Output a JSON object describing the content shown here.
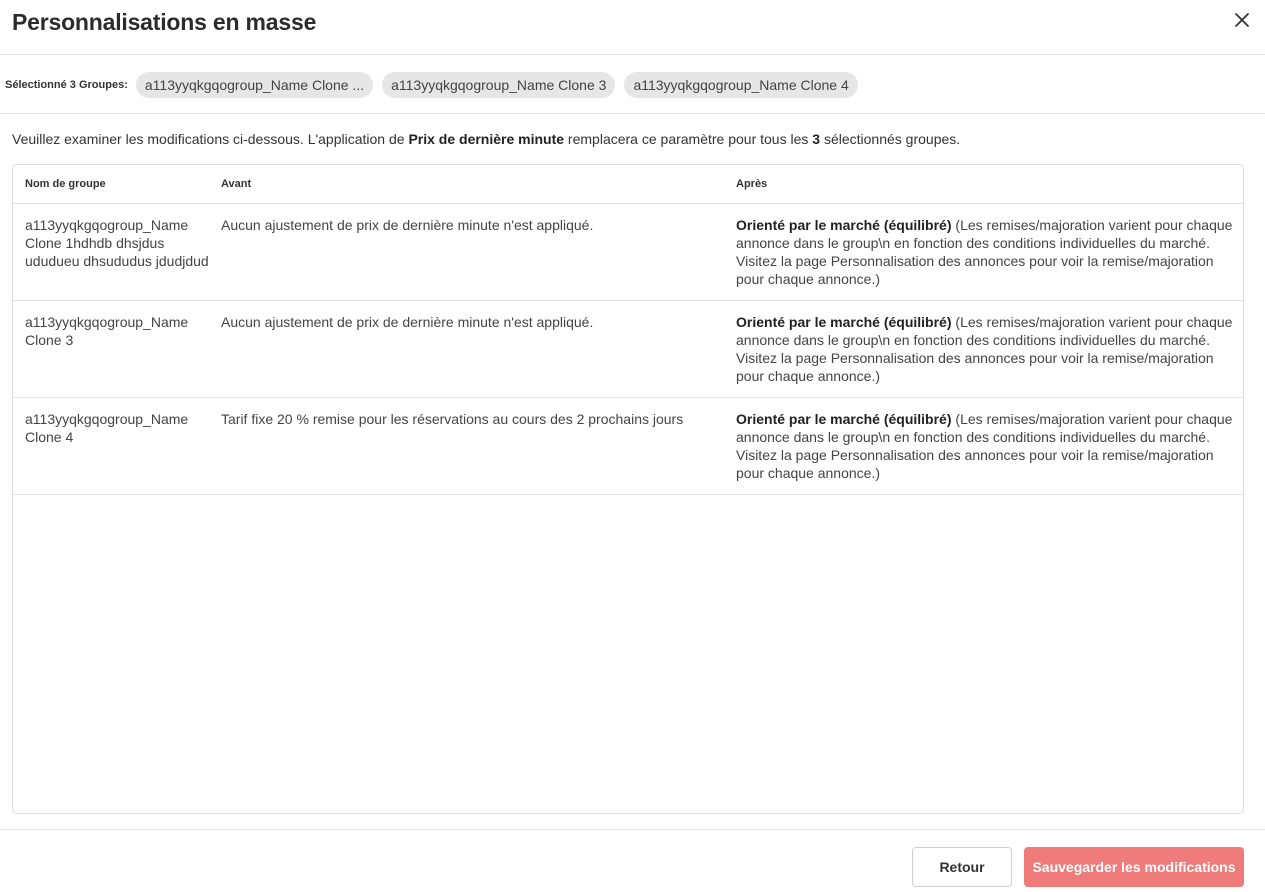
{
  "dialog": {
    "title": "Personnalisations en masse",
    "close_icon": "close-icon"
  },
  "selection": {
    "label": "Sélectionné 3 Groupes:",
    "chips": [
      "a113yyqkgqogroup_Name Clone ...",
      "a113yyqkgqogroup_Name Clone 3",
      "a113yyqkgqogroup_Name Clone 4"
    ]
  },
  "notice": {
    "prefix": "Veuillez examiner les modifications ci-dessous. L'application de ",
    "setting": "Prix de dernière minute",
    "middle": " remplacera ce paramètre pour tous les ",
    "count": "3",
    "suffix": " sélectionnés groupes."
  },
  "table": {
    "headers": [
      "Nom de groupe",
      "Avant",
      "Après"
    ],
    "rows": [
      {
        "name": "a113yyqkgqogroup_Name Clone 1hdhdb dhsjdus ududueu dhsududus jdudjdud",
        "before": "Aucun ajustement de prix de dernière minute n'est appliqué.",
        "after_bold": "Orienté par le marché (équilibré)",
        "after_text": " (Les remises/majoration varient pour chaque annonce dans le group\\n en fonction des conditions individuelles du marché. Visitez la page Personnalisation des annonces pour voir la remise/majoration pour chaque annonce.)"
      },
      {
        "name": "a113yyqkgqogroup_Name Clone 3",
        "before": "Aucun ajustement de prix de dernière minute n'est appliqué.",
        "after_bold": "Orienté par le marché (équilibré)",
        "after_text": " (Les remises/majoration varient pour chaque annonce dans le group\\n en fonction des conditions individuelles du marché. Visitez la page Personnalisation des annonces pour voir la remise/majoration pour chaque annonce.)"
      },
      {
        "name": "a113yyqkgqogroup_Name Clone 4",
        "before": "Tarif fixe 20 % remise pour les réservations au cours des 2 prochains jours",
        "after_bold": "Orienté par le marché (équilibré)",
        "after_text": " (Les remises/majoration varient pour chaque annonce dans le group\\n en fonction des conditions individuelles du marché. Visitez la page Personnalisation des annonces pour voir la remise/majoration pour chaque annonce.)"
      }
    ]
  },
  "footer": {
    "back_label": "Retour",
    "save_label": "Sauvegarder les modifications"
  },
  "colors": {
    "save_button": "#f07b7b",
    "chip_bg": "#e6e6e6",
    "border": "#e3e3e3"
  }
}
